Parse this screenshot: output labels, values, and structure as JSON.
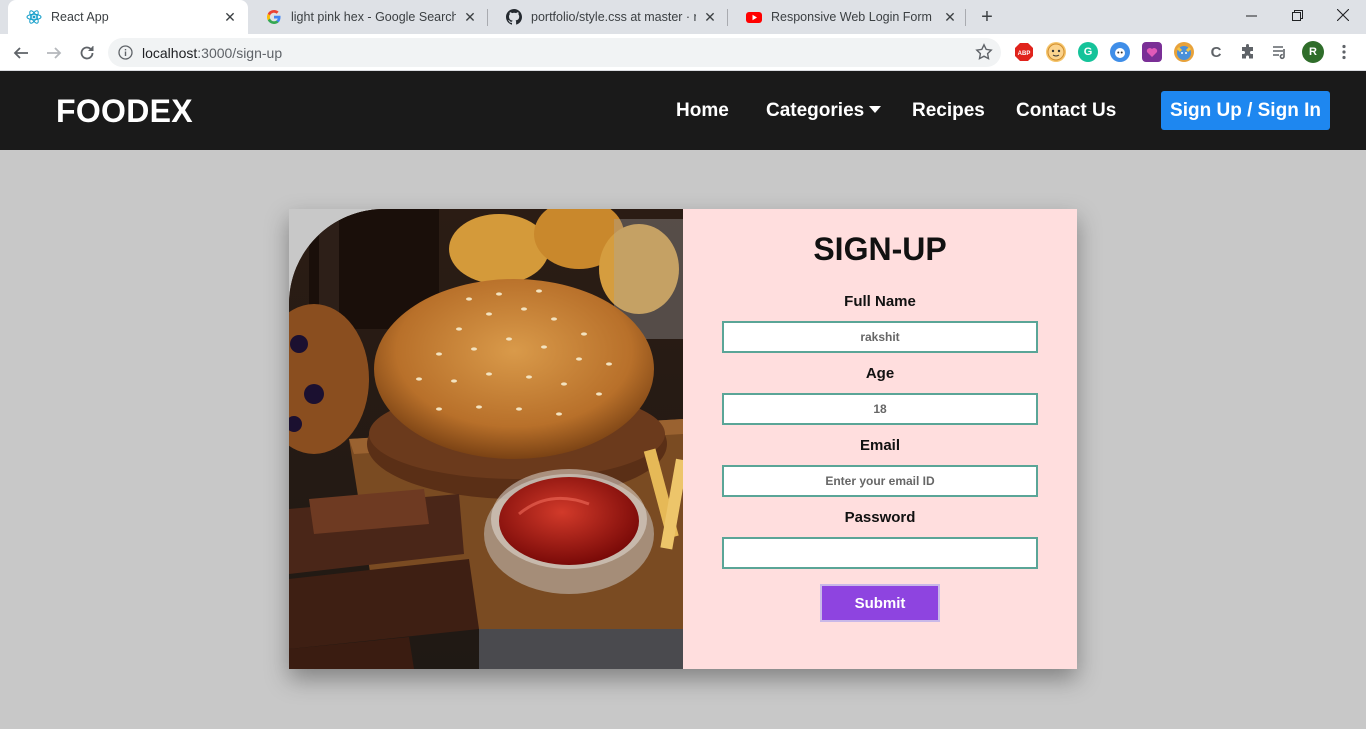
{
  "browser": {
    "tabs": [
      {
        "label": "React App",
        "active": true
      },
      {
        "label": "light pink hex - Google Search",
        "active": false
      },
      {
        "label": "portfolio/style.css at master · raks",
        "active": false
      },
      {
        "label": "Responsive Web Login Form | Re",
        "active": false
      }
    ],
    "url_host": "localhost",
    "url_path": ":3000/sign-up",
    "extensions": [
      {
        "name": "abp-icon",
        "label": "ABP",
        "color": "#e0231c"
      },
      {
        "name": "emoji-extension-icon",
        "label": "",
        "color": "#f5c46a"
      },
      {
        "name": "grammarly-icon",
        "label": "G",
        "color": "#15c39a"
      },
      {
        "name": "face-extension-icon",
        "label": "",
        "color": "#3f8ee8"
      },
      {
        "name": "purple-extension-icon",
        "label": "",
        "color": "#7a2f96"
      },
      {
        "name": "cat-extension-icon",
        "label": "",
        "color": "#e8a23a"
      },
      {
        "name": "code-extension-icon",
        "label": "C",
        "color": "#8a8a8a"
      }
    ],
    "profile_initial": "R",
    "profile_color": "#2f6d2a"
  },
  "nav": {
    "brand": "FOODEX",
    "links": [
      "Home",
      "Categories",
      "Recipes",
      "Contact Us"
    ],
    "cta": "Sign Up / Sign In",
    "cta_color": "#1e87f0"
  },
  "form": {
    "title": "SIGN-UP",
    "fields": [
      {
        "label": "Full Name",
        "value": "rakshit",
        "placeholder": ""
      },
      {
        "label": "Age",
        "value": "18",
        "placeholder": ""
      },
      {
        "label": "Email",
        "value": "",
        "placeholder": "Enter your email ID"
      },
      {
        "label": "Password",
        "value": "",
        "placeholder": ""
      }
    ],
    "submit": "Submit",
    "panel_color": "#ffdede",
    "submit_color": "#8e44e0"
  }
}
